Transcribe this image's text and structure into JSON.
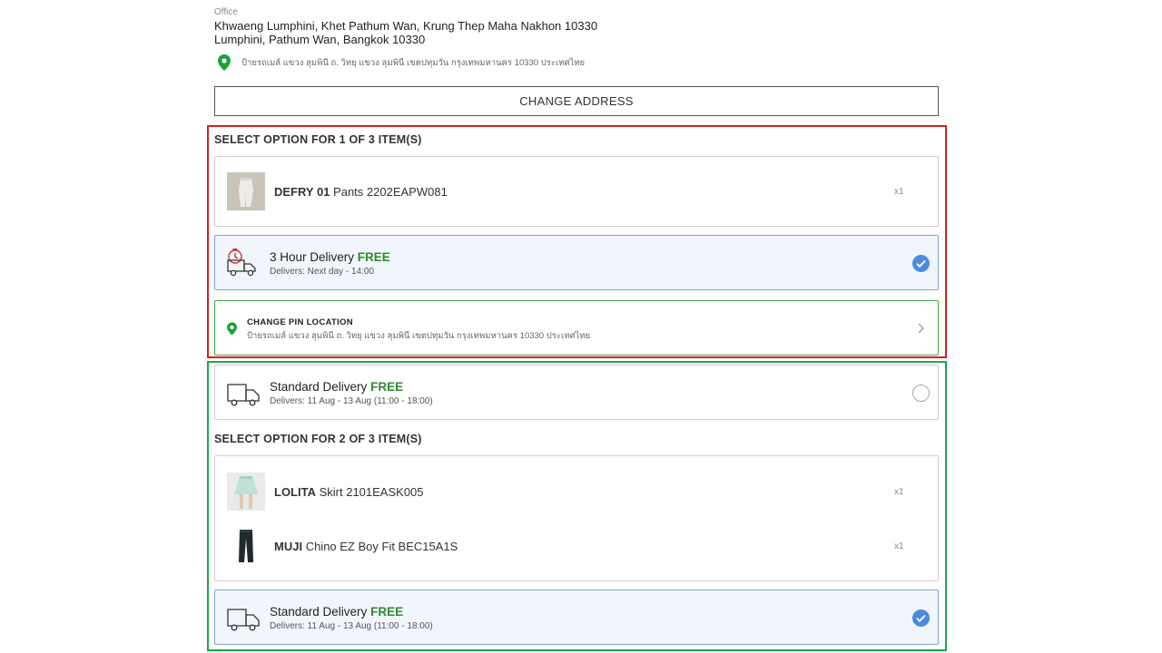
{
  "address": {
    "label": "Office",
    "line1": "Khwaeng Lumphini, Khet Pathum Wan, Krung Thep Maha Nakhon 10330",
    "line2": "Lumphini, Pathum Wan, Bangkok 10330",
    "pin_text": "ป้ายรถเมล์ แขวง ลุมพินี ถ. วิทยุ แขวง ลุมพินี เขตปทุมวัน กรุงเทพมหานคร 10330 ประเทศไทย",
    "pin_icon": "map-pin-icon",
    "change_button": "CHANGE ADDRESS"
  },
  "group1": {
    "title": "SELECT OPTION FOR 1 OF 3 ITEM(S)",
    "items": [
      {
        "brand": "DEFRY 01",
        "desc": "Pants 2202EAPW081",
        "qty": "x1",
        "thumb": "white-pants-thumbnail"
      }
    ],
    "delivery": {
      "title": "3 Hour Delivery",
      "free": "FREE",
      "sub": "Delivers: Next day - 14:00",
      "icon": "express-truck-icon",
      "selected": true
    },
    "pin_location": {
      "title": "CHANGE PIN LOCATION",
      "sub": "ป้ายรถเมล์ แขวง ลุมพินี ถ. วิทยุ แขวง ลุมพินี เขตปทุมวัน กรุงเทพมหานคร 10330 ประเทศไทย",
      "icon": "map-pin-icon"
    },
    "standard": {
      "title": "Standard Delivery",
      "free": "FREE",
      "sub": "Delivers: 11 Aug - 13 Aug (11:00 - 18:00)",
      "icon": "truck-icon",
      "selected": false
    }
  },
  "group2": {
    "title": "SELECT OPTION FOR 2 OF 3 ITEM(S)",
    "items": [
      {
        "brand": "LOLITA",
        "desc": "Skirt 2101EASK005",
        "qty": "x1",
        "thumb": "skirt-thumbnail"
      },
      {
        "brand": "MUJI",
        "desc": "Chino EZ Boy Fit BEC15A1S",
        "qty": "x1",
        "thumb": "chino-thumbnail"
      }
    ],
    "delivery": {
      "title": "Standard Delivery",
      "free": "FREE",
      "sub": "Delivers: 11 Aug - 13 Aug (11:00 - 18:00)",
      "icon": "truck-icon",
      "selected": true
    }
  },
  "colors": {
    "free_green": "#2e8b2e",
    "selected_bg": "#f1f6fc",
    "radio_blue": "#4a8be0",
    "pin_green": "#1aa33a",
    "outline_red": "#d42020",
    "outline_green": "#1fa64f"
  }
}
